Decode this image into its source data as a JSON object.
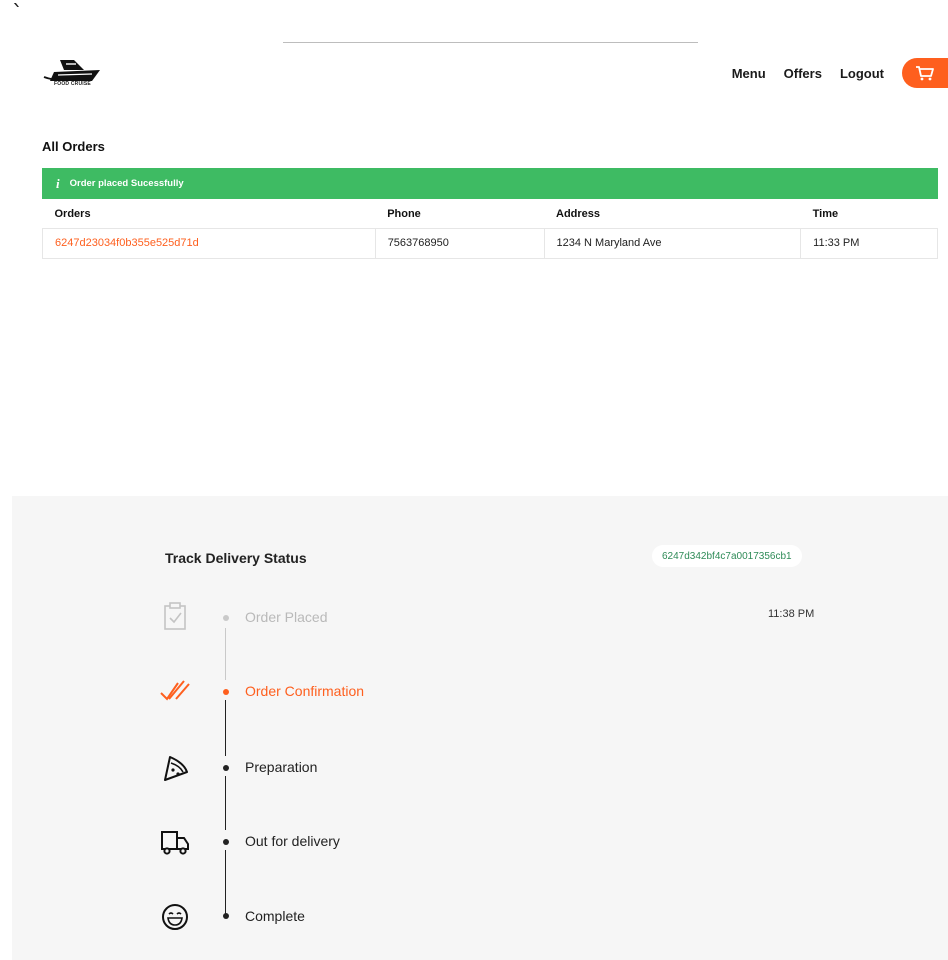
{
  "stray_mark": "`",
  "brand": {
    "logo_text": "FOOD CRUISE"
  },
  "nav": {
    "items": [
      {
        "label": "Menu"
      },
      {
        "label": "Offers"
      },
      {
        "label": "Logout"
      }
    ]
  },
  "orders_page": {
    "title": "All Orders",
    "alert": {
      "icon": "i",
      "message": "Order placed Sucessfully"
    },
    "columns": [
      "Orders",
      "Phone",
      "Address",
      "Time"
    ],
    "rows": [
      {
        "id": "6247d23034f0b355e525d71d",
        "phone": "7563768950",
        "address": "1234 N Maryland Ave",
        "time": "11:33 PM"
      }
    ]
  },
  "tracking": {
    "title": "Track Delivery Status",
    "order_id": "6247d342bf4c7a0017356cb1",
    "time": "11:38 PM",
    "steps": [
      {
        "label": "Order Placed",
        "icon": "clipboard-check-icon",
        "state": "done"
      },
      {
        "label": "Order Confirmation",
        "icon": "double-check-icon",
        "state": "current"
      },
      {
        "label": "Preparation",
        "icon": "pizza-slice-icon",
        "state": "pending"
      },
      {
        "label": "Out for delivery",
        "icon": "delivery-truck-icon",
        "state": "pending"
      },
      {
        "label": "Complete",
        "icon": "smile-icon",
        "state": "pending"
      }
    ]
  },
  "colors": {
    "accent": "#fe5f1e",
    "success": "#3ebb63",
    "muted": "#b9b9b9",
    "panel": "#f6f6f6"
  }
}
